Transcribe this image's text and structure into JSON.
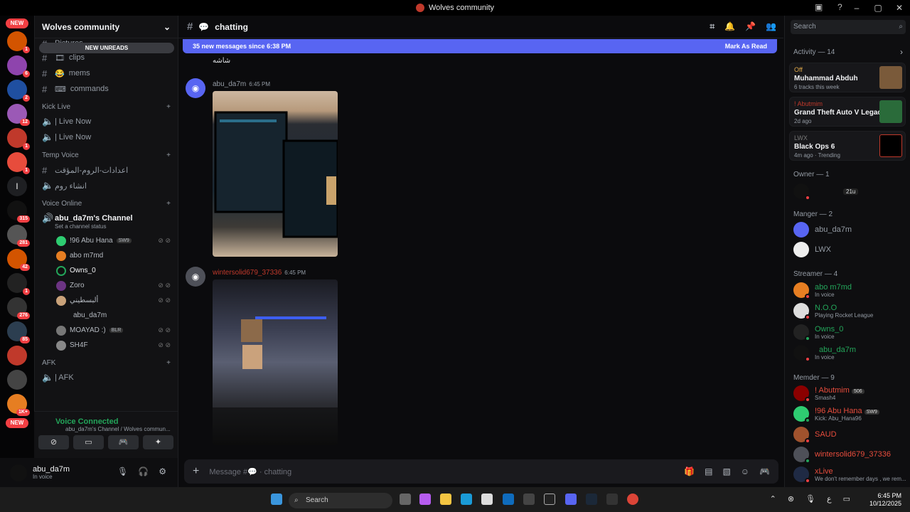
{
  "window": {
    "title": "Wolves community"
  },
  "servers": {
    "top_new": "NEW",
    "bottom_new": "NEW",
    "badges": [
      "1",
      "6",
      "2",
      "12",
      "1",
      "1",
      "315",
      "281",
      "42",
      "1",
      "276",
      "85",
      "1K+"
    ],
    "single_letter": "l"
  },
  "guild": {
    "name": "Wolves community",
    "new_unreads": "NEW UNREADS",
    "partial_top": "Pictures"
  },
  "channels": [
    {
      "icon": "#",
      "name": "clips"
    },
    {
      "icon": "#",
      "name": "mems"
    },
    {
      "icon": "#",
      "name": "commands"
    }
  ],
  "kick_live": {
    "label": "Kick Live",
    "items": [
      "| Live Now",
      "| Live Now"
    ]
  },
  "temp_voice": {
    "label": "Temp Voice",
    "items": [
      "اعدادات-الروم-المؤقت",
      "انشاء روم"
    ]
  },
  "voice_online": {
    "label": "Voice Online",
    "channel": "abu_da7m's Channel",
    "status": "Set a channel status",
    "users": [
      {
        "name": "!96 Abu Hana",
        "tag": "SW9"
      },
      {
        "name": "abo m7md",
        "tag": ""
      },
      {
        "name": "Owns_0",
        "tag": ""
      },
      {
        "name": "Zoro",
        "tag": ""
      },
      {
        "name": "ألبسطيني",
        "tag": ""
      },
      {
        "name": "abu_da7m",
        "tag": ""
      },
      {
        "name": "MOAYAD :)",
        "tag": "BLR"
      },
      {
        "name": "SH4F",
        "tag": ""
      }
    ]
  },
  "afk": {
    "label": "AFK",
    "item": "| AFK"
  },
  "voice_bar": {
    "status": "Voice Connected",
    "location": "abu_da7m's Channel / Wolves commun..."
  },
  "user": {
    "name": "abu_da7m",
    "status": "In voice"
  },
  "chat": {
    "channel": "chatting",
    "new_messages": "35 new messages since 6:38 PM",
    "mark_read": "Mark As Read",
    "partial_text": "شاشه",
    "messages": [
      {
        "author": "abu_da7m",
        "time": "6:45 PM",
        "color": "#949ba4"
      },
      {
        "author": "wintersolid679_37336",
        "time": "6:45 PM",
        "color": "#c0392b"
      }
    ],
    "placeholder": "Message #💬 · chatting"
  },
  "members": {
    "search_placeholder": "Search",
    "activity_header": "Activity — 14",
    "activities": [
      {
        "status": "Off",
        "title": "Muhammad Abduh",
        "sub": "6 tracks this week"
      },
      {
        "status": "! Abutmim",
        "title": "Grand Theft Auto V Legacy",
        "sub": "2d ago"
      },
      {
        "status": "LWX",
        "title": "Black Ops 6",
        "sub": "4m ago · Trending"
      }
    ],
    "owner_header": "Owner — 1",
    "owner_badge": "21u",
    "manager_header": "Manger — 2",
    "managers": [
      "abu_da7m",
      "LWX"
    ],
    "streamer_header": "Streamer — 4",
    "streamers": [
      {
        "name": "abo m7md",
        "status": "In voice"
      },
      {
        "name": "N.O.O",
        "status": "Playing Rocket League"
      },
      {
        "name": "Owns_0",
        "status": "In voice"
      },
      {
        "name": "abu_da7m",
        "status": "In voice"
      }
    ],
    "member_header": "Memder — 9",
    "members_list": [
      {
        "name": "! Abutmim",
        "tag": "506",
        "status": "Smash4"
      },
      {
        "name": "!96 Abu Hana",
        "tag": "SW9",
        "status": "Kick: Abu_Hana96"
      },
      {
        "name": "SAUD",
        "tag": "",
        "status": ""
      },
      {
        "name": "wintersolid679_37336",
        "tag": "",
        "status": ""
      },
      {
        "name": "xLive",
        "tag": "",
        "status": "We don't remember days , we rem..."
      }
    ]
  },
  "taskbar": {
    "search": "Search",
    "time": "6:45 PM",
    "date": "10/12/2025",
    "lang": "ع"
  }
}
